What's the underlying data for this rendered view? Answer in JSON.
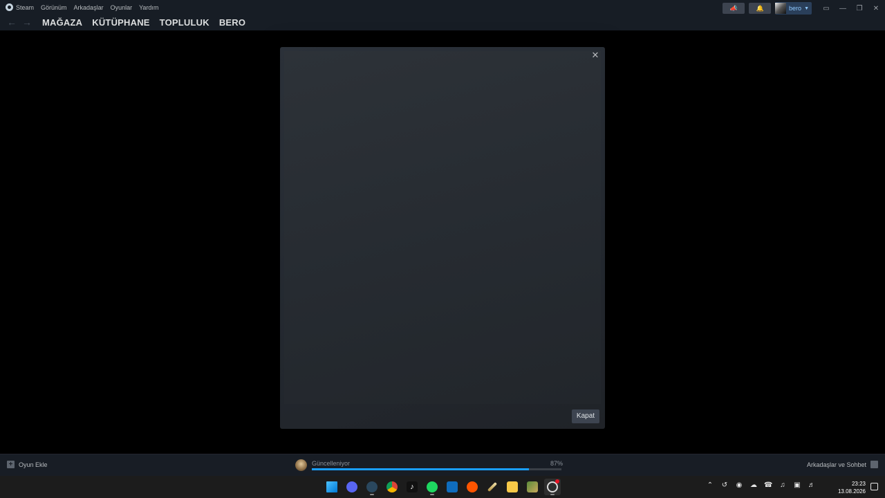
{
  "menu": {
    "items": [
      "Steam",
      "Görünüm",
      "Arkadaşlar",
      "Oyunlar",
      "Yardım"
    ]
  },
  "nav": {
    "links": [
      "MAĞAZA",
      "KÜTÜPHANE",
      "TOPLULUK",
      "BERO"
    ]
  },
  "user": {
    "name": "bero"
  },
  "modal": {
    "close_label": "Kapat"
  },
  "status_bar": {
    "add_game_label": "Oyun Ekle",
    "download_status": "Güncelleniyor",
    "download_percent_label": "87%",
    "download_progress": 0.87,
    "friends_label": "Arkadaşlar ve Sohbet"
  },
  "taskbar": {
    "apps": [
      "windows-start-icon",
      "discord-icon",
      "steam-icon",
      "chrome-icon",
      "tiktok-icon",
      "spotify-icon",
      "mail-icon",
      "soundcloud-icon",
      "pen-icon",
      "file-explorer-icon",
      "app-icon",
      "ring-app-icon"
    ],
    "time": "23:23",
    "date": "13.08.2026"
  },
  "colors": {
    "accent": "#1a9fff",
    "titlebar_bg": "#171d25",
    "modal_bg": "#2b3139"
  }
}
